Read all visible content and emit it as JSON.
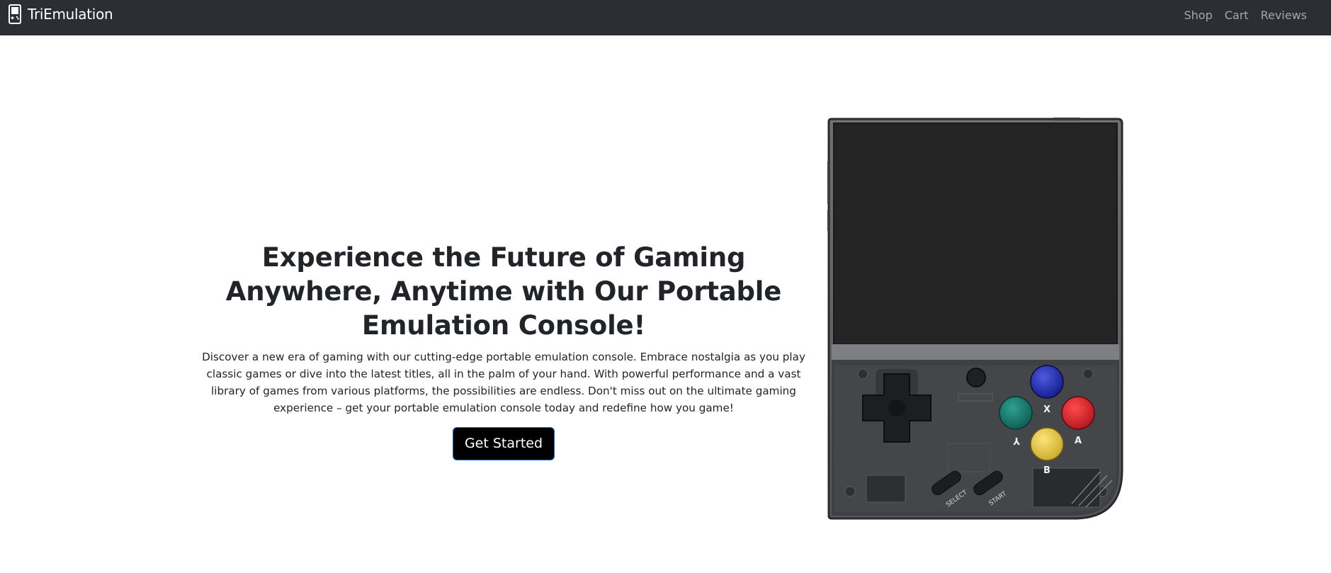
{
  "navbar": {
    "brand": "TriEmulation",
    "brand_icon": "handheld-console-icon",
    "links": [
      "Shop",
      "Cart",
      "Reviews"
    ],
    "background": "#2b2f33"
  },
  "hero": {
    "title": "Experience the Future of Gaming Anywhere, Anytime with Our Portable Emulation Console!",
    "description": "Discover a new era of gaming with our cutting-edge portable emulation console. Embrace nostalgia as you play classic games or dive into the latest titles, all in the palm of your hand. With powerful performance and a vast library of games from various platforms, the possibilities are endless. Don't miss out on the ultimate gaming experience – get your portable emulation console today and redefine how you game!",
    "cta_label": "Get Started"
  },
  "product_image": {
    "button_labels": {
      "x": "X",
      "y": "Y",
      "a": "A",
      "b": "B",
      "select": "SELECT",
      "start": "START"
    },
    "colors": {
      "x_button": "#1d2aa3",
      "y_button": "#1b7a6c",
      "a_button": "#d01f25",
      "b_button": "#e5c93c",
      "screen": "#242424"
    }
  }
}
